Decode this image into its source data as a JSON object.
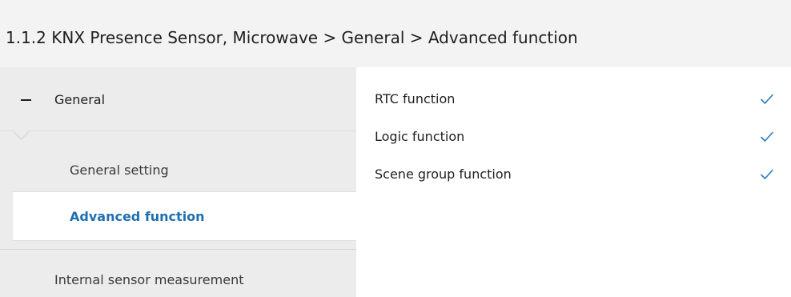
{
  "header": {
    "title": "1.1.2 KNX Presence Sensor, Microwave > General > Advanced function"
  },
  "sidebar": {
    "group": {
      "label": "General",
      "icon": "minus-icon",
      "expanded": true
    },
    "items": [
      {
        "label": "General setting",
        "selected": false
      },
      {
        "label": "Advanced function",
        "selected": true
      },
      {
        "label": "Internal sensor measurement",
        "selected": false
      }
    ]
  },
  "settings": [
    {
      "label": "RTC function",
      "checked": true
    },
    {
      "label": "Logic function",
      "checked": true
    },
    {
      "label": "Scene group function",
      "checked": true
    }
  ],
  "colors": {
    "accent": "#1f6fb2",
    "check": "#2b7bc0",
    "sidebar_bg": "#ececec",
    "header_bg": "#f3f3f3"
  }
}
